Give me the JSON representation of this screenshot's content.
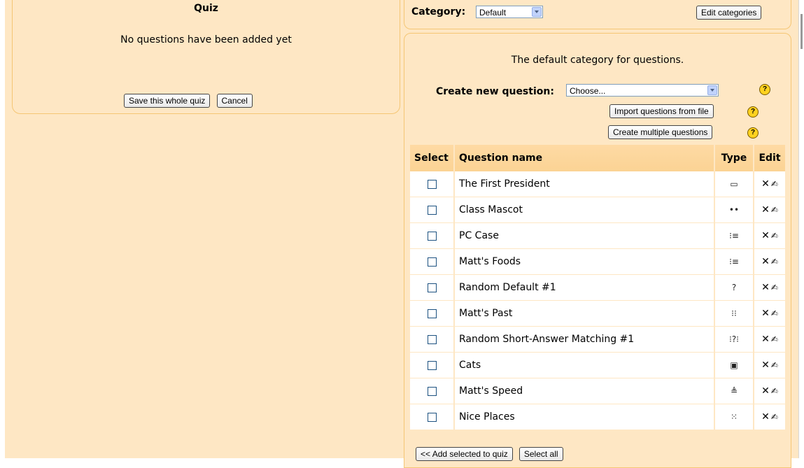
{
  "quiz": {
    "title": "Quiz",
    "empty_message": "No questions have been added yet",
    "save_label": "Save this whole quiz",
    "cancel_label": "Cancel"
  },
  "category": {
    "label": "Category:",
    "selected": "Default",
    "edit_label": "Edit categories"
  },
  "bank": {
    "description": "The default category for questions.",
    "create_label": "Create new question:",
    "create_selected": "Choose...",
    "import_label": "Import questions from file",
    "multiple_label": "Create multiple questions",
    "help_glyph": "?",
    "add_selected_label": "<< Add selected to quiz",
    "select_all_label": "Select all"
  },
  "table": {
    "headers": [
      "Select",
      "Question name",
      "Type",
      "Edit"
    ],
    "rows": [
      {
        "name": "The First President",
        "type_icon": "short-answer-icon",
        "glyph": "▭"
      },
      {
        "name": "Class Mascot",
        "type_icon": "true-false-icon",
        "glyph": "••"
      },
      {
        "name": "PC Case",
        "type_icon": "multiple-choice-icon",
        "glyph": "⁝≡"
      },
      {
        "name": "Matt's Foods",
        "type_icon": "multiple-choice-icon",
        "glyph": "⁝≡"
      },
      {
        "name": "Random Default #1",
        "type_icon": "random-icon",
        "glyph": "?"
      },
      {
        "name": "Matt's Past",
        "type_icon": "matching-icon",
        "glyph": "⁝⁝"
      },
      {
        "name": "Random Short-Answer Matching #1",
        "type_icon": "random-matching-icon",
        "glyph": "⁝?⁝"
      },
      {
        "name": "Cats",
        "type_icon": "essay-icon",
        "glyph": "▣"
      },
      {
        "name": "Matt's Speed",
        "type_icon": "numerical-icon",
        "glyph": "≜"
      },
      {
        "name": "Nice Places",
        "type_icon": "cloze-icon",
        "glyph": "⁙"
      }
    ],
    "delete_glyph": "✕",
    "edit_glyph": "✍"
  }
}
